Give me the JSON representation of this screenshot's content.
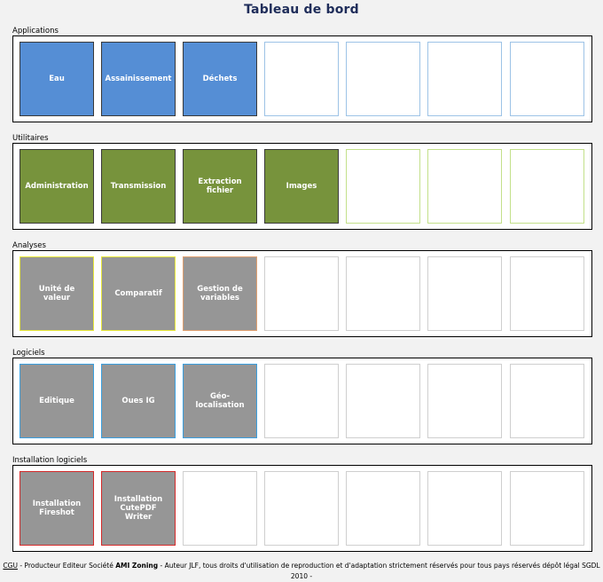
{
  "title": "Tableau de bord",
  "sections": [
    {
      "label": "Applications",
      "tiles": [
        {
          "label": "Eau",
          "bg": "#558ed5",
          "border": "#3a3a3a"
        },
        {
          "label": "Assainissement",
          "bg": "#558ed5",
          "border": "#3a3a3a"
        },
        {
          "label": "Déchets",
          "bg": "#558ed5",
          "border": "#3a3a3a"
        },
        {
          "label": "",
          "bg": "#ffffff",
          "border": "#9dc3e6"
        },
        {
          "label": "",
          "bg": "#ffffff",
          "border": "#9dc3e6"
        },
        {
          "label": "",
          "bg": "#ffffff",
          "border": "#9dc3e6"
        },
        {
          "label": "",
          "bg": "#ffffff",
          "border": "#9dc3e6"
        }
      ]
    },
    {
      "label": "Utilitaires",
      "tiles": [
        {
          "label": "Administration",
          "bg": "#77933c",
          "border": "#3a3a3a"
        },
        {
          "label": "Transmission",
          "bg": "#77933c",
          "border": "#3a3a3a"
        },
        {
          "label": "Extraction fichier",
          "bg": "#77933c",
          "border": "#3a3a3a"
        },
        {
          "label": "Images",
          "bg": "#77933c",
          "border": "#3a3a3a"
        },
        {
          "label": "",
          "bg": "#ffffff",
          "border": "#c3e08a"
        },
        {
          "label": "",
          "bg": "#ffffff",
          "border": "#c3e08a"
        },
        {
          "label": "",
          "bg": "#ffffff",
          "border": "#c3e08a"
        }
      ]
    },
    {
      "label": "Analyses",
      "tiles": [
        {
          "label": "Unité de valeur",
          "bg": "#969696",
          "border": "#e8e83a"
        },
        {
          "label": "Comparatif",
          "bg": "#969696",
          "border": "#e8e83a"
        },
        {
          "label": "Gestion de variables",
          "bg": "#969696",
          "border": "#e0a070"
        },
        {
          "label": "",
          "bg": "#ffffff",
          "border": "#cfcfcf"
        },
        {
          "label": "",
          "bg": "#ffffff",
          "border": "#cfcfcf"
        },
        {
          "label": "",
          "bg": "#ffffff",
          "border": "#cfcfcf"
        },
        {
          "label": "",
          "bg": "#ffffff",
          "border": "#cfcfcf"
        }
      ]
    },
    {
      "label": "Logiciels",
      "tiles": [
        {
          "label": "Editique",
          "bg": "#969696",
          "border": "#3aa0e0"
        },
        {
          "label": "Oues IG",
          "bg": "#969696",
          "border": "#3aa0e0"
        },
        {
          "label": "Géo-localisation",
          "bg": "#969696",
          "border": "#3aa0e0"
        },
        {
          "label": "",
          "bg": "#ffffff",
          "border": "#cfcfcf"
        },
        {
          "label": "",
          "bg": "#ffffff",
          "border": "#cfcfcf"
        },
        {
          "label": "",
          "bg": "#ffffff",
          "border": "#cfcfcf"
        },
        {
          "label": "",
          "bg": "#ffffff",
          "border": "#cfcfcf"
        }
      ]
    },
    {
      "label": "Installation logiciels",
      "tiles": [
        {
          "label": "Installation Fireshot",
          "bg": "#969696",
          "border": "#d42a2a"
        },
        {
          "label": "Installation CutePDF Writer",
          "bg": "#969696",
          "border": "#d42a2a"
        },
        {
          "label": "",
          "bg": "#ffffff",
          "border": "#cfcfcf"
        },
        {
          "label": "",
          "bg": "#ffffff",
          "border": "#cfcfcf"
        },
        {
          "label": "",
          "bg": "#ffffff",
          "border": "#cfcfcf"
        },
        {
          "label": "",
          "bg": "#ffffff",
          "border": "#cfcfcf"
        },
        {
          "label": "",
          "bg": "#ffffff",
          "border": "#cfcfcf"
        }
      ]
    }
  ],
  "footer": {
    "cgu_link": "CGU",
    "text_1": " - Producteur Editeur Société ",
    "company": "AMI Zoning",
    "text_2": " - Auteur JLF, tous droits d'utilisation de reproduction et d'adaptation strictement réservés pour tous pays réservés dépôt légal SGDL 2010 -"
  }
}
